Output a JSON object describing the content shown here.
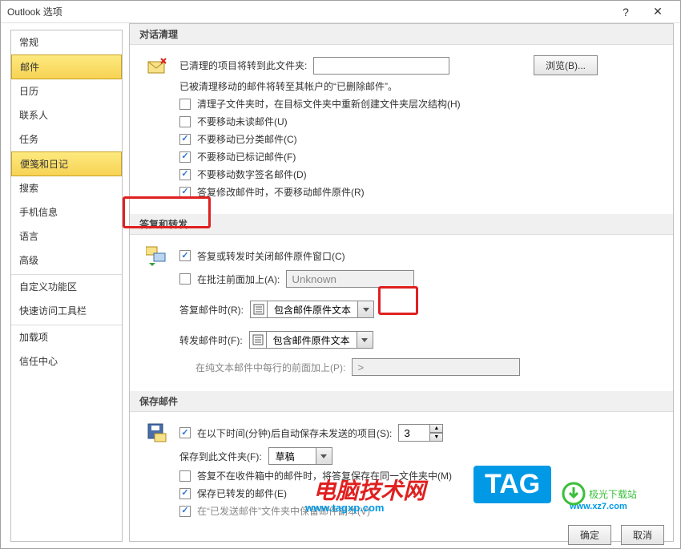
{
  "titlebar": {
    "title": "Outlook 选项",
    "help": "?",
    "close": "✕"
  },
  "sidebar": {
    "items": [
      {
        "label": "常规"
      },
      {
        "label": "邮件"
      },
      {
        "label": "日历"
      },
      {
        "label": "联系人"
      },
      {
        "label": "任务"
      },
      {
        "label": "便笺和日记"
      },
      {
        "label": "搜索"
      },
      {
        "label": "手机信息"
      },
      {
        "label": "语言"
      },
      {
        "label": "高级"
      },
      {
        "label": "自定义功能区"
      },
      {
        "label": "快速访问工具栏"
      },
      {
        "label": "加载项"
      },
      {
        "label": "信任中心"
      }
    ]
  },
  "cleanup": {
    "header": "对话清理",
    "moved_to_label": "已清理的项目将转到此文件夹:",
    "browse": "浏览(B)...",
    "note": "已被清理移动的邮件将转至其帐户的“已删除邮件”。",
    "c1": "清理子文件夹时，在目标文件夹中重新创建文件夹层次结构(H)",
    "c2": "不要移动未读邮件(U)",
    "c3": "不要移动已分类邮件(C)",
    "c4": "不要移动已标记邮件(F)",
    "c5": "不要移动数字签名邮件(D)",
    "c6": "答复修改邮件时，不要移动邮件原件(R)"
  },
  "reply": {
    "header": "答复和转发",
    "close_original": "答复或转发时关闭邮件原件窗口(C)",
    "prefix_label": "在批注前面加上(A):",
    "prefix_value": "Unknown",
    "when_reply_label": "答复邮件时(R):",
    "include_text": "包含邮件原件文本",
    "when_forward_label": "转发邮件时(F):",
    "plain_prefix_label": "在纯文本邮件中每行的前面加上(P):",
    "plain_prefix_value": ">"
  },
  "save": {
    "header": "保存邮件",
    "autosave": "在以下时间(分钟)后自动保存未发送的项目(S):",
    "autosave_value": "3",
    "folder_label": "保存到此文件夹(F):",
    "folder_value": "草稿",
    "c1": "答复不在收件箱中的邮件时，将答复保存在同一文件夹中(M)",
    "c2": "保存已转发的邮件(E)",
    "c3": "在“已发送邮件”文件夹中保留邮件副本(V)"
  },
  "footer": {
    "ok": "确定",
    "cancel": "取消"
  },
  "overlay": {
    "brand": "电脑技术网",
    "url": "www.tagxp.com",
    "tag": "TAG",
    "dlsite": "极光下载站",
    "dlurl": "www.xz7.com"
  }
}
